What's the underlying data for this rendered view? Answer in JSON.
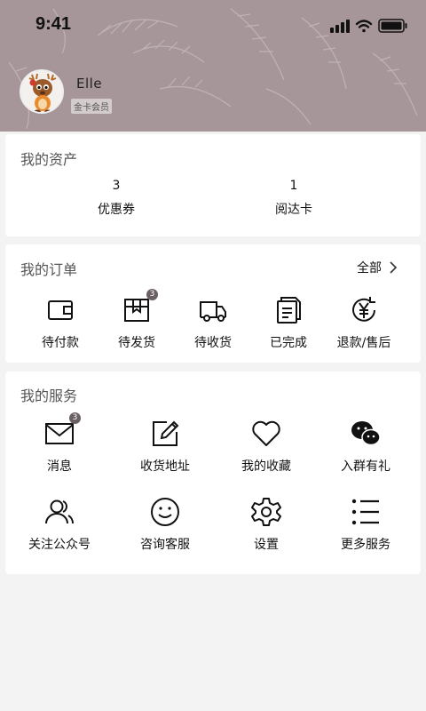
{
  "status_bar": {
    "time": "9:41"
  },
  "profile": {
    "name": "Elle",
    "member_level": "金卡会员"
  },
  "assets": {
    "title": "我的资产",
    "items": [
      {
        "value": "3",
        "label": "优惠券"
      },
      {
        "value": "1",
        "label": "阅达卡"
      }
    ]
  },
  "orders": {
    "title": "我的订单",
    "all_label": "全部",
    "items": [
      {
        "label": "待付款",
        "icon": "wallet-icon"
      },
      {
        "label": "待发货",
        "icon": "package-icon",
        "badge": "3"
      },
      {
        "label": "待收货",
        "icon": "truck-icon"
      },
      {
        "label": "已完成",
        "icon": "documents-icon"
      },
      {
        "label": "退款/售后",
        "icon": "yen-refund-icon"
      }
    ]
  },
  "services": {
    "title": "我的服务",
    "items": [
      {
        "label": "消息",
        "icon": "mail-icon",
        "badge": "3"
      },
      {
        "label": "收货地址",
        "icon": "edit-icon"
      },
      {
        "label": "我的收藏",
        "icon": "heart-icon"
      },
      {
        "label": "入群有礼",
        "icon": "wechat-icon"
      },
      {
        "label": "关注公众号",
        "icon": "users-icon"
      },
      {
        "label": "咨询客服",
        "icon": "smile-icon"
      },
      {
        "label": "设置",
        "icon": "gear-icon"
      },
      {
        "label": "更多服务",
        "icon": "list-icon"
      }
    ]
  },
  "colors": {
    "header_bg": "#a6969a",
    "badge_bg": "#6a6064",
    "page_bg": "#f3f3f3"
  }
}
